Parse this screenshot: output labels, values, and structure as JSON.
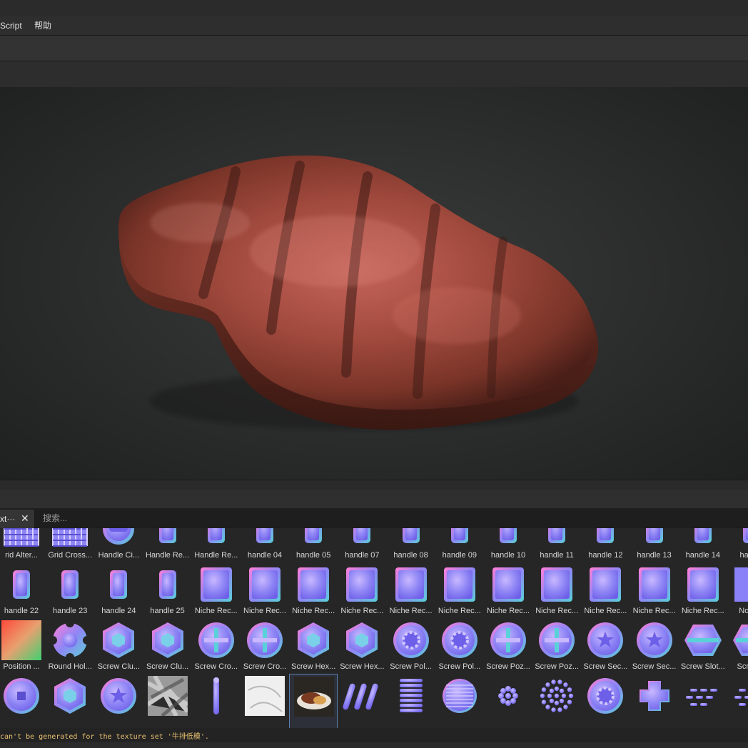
{
  "menubar": {
    "items": [
      {
        "label": "Script"
      },
      {
        "label": "帮助"
      }
    ]
  },
  "viewport": {
    "object": "grilled steak 3D model",
    "background": "#2c2d2d"
  },
  "shelf": {
    "tab_label": "xt···",
    "search_placeholder": "搜索...",
    "rows": [
      [
        {
          "label": "rid Alter...",
          "icon": "grid-alternate-icon"
        },
        {
          "label": "Grid Cross...",
          "icon": "grid-cross-icon"
        },
        {
          "label": "Handle Ci...",
          "icon": "handle-circle-icon"
        },
        {
          "label": "Handle Re...",
          "icon": "handle-rect-icon"
        },
        {
          "label": "Handle Re...",
          "icon": "handle-rect-icon"
        },
        {
          "label": "handle 04",
          "icon": "handle-icon"
        },
        {
          "label": "handle 05",
          "icon": "handle-icon"
        },
        {
          "label": "handle 07",
          "icon": "handle-icon"
        },
        {
          "label": "handle 08",
          "icon": "handle-icon"
        },
        {
          "label": "handle 09",
          "icon": "handle-icon"
        },
        {
          "label": "handle 10",
          "icon": "handle-icon"
        },
        {
          "label": "handle 11",
          "icon": "handle-icon"
        },
        {
          "label": "handle 12",
          "icon": "handle-icon"
        },
        {
          "label": "handle 13",
          "icon": "handle-icon"
        },
        {
          "label": "handle 14",
          "icon": "handle-icon"
        },
        {
          "label": "handle",
          "icon": "handle-icon"
        }
      ],
      [
        {
          "label": "handle 22",
          "icon": "handle-icon"
        },
        {
          "label": "handle 23",
          "icon": "handle-icon"
        },
        {
          "label": "handle 24",
          "icon": "handle-icon"
        },
        {
          "label": "handle 25",
          "icon": "handle-icon"
        },
        {
          "label": "Niche Rec...",
          "icon": "niche-rect-icon"
        },
        {
          "label": "Niche Rec...",
          "icon": "niche-rect-icon"
        },
        {
          "label": "Niche Rec...",
          "icon": "niche-rect-icon"
        },
        {
          "label": "Niche Rec...",
          "icon": "niche-rect-icon"
        },
        {
          "label": "Niche Rec...",
          "icon": "niche-rect-icon"
        },
        {
          "label": "Niche Rec...",
          "icon": "niche-rect-icon"
        },
        {
          "label": "Niche Rec...",
          "icon": "niche-rect-icon"
        },
        {
          "label": "Niche Rec...",
          "icon": "niche-rect-icon"
        },
        {
          "label": "Niche Rec...",
          "icon": "niche-rect-icon"
        },
        {
          "label": "Niche Rec...",
          "icon": "niche-rect-icon"
        },
        {
          "label": "Niche Rec...",
          "icon": "niche-rect-icon"
        },
        {
          "label": "Normal",
          "icon": "normal-icon"
        }
      ],
      [
        {
          "label": "Position ...",
          "icon": "position-gradient-icon"
        },
        {
          "label": "Round Hol...",
          "icon": "round-hole-icon"
        },
        {
          "label": "Screw Clu...",
          "icon": "screw-clutch-icon"
        },
        {
          "label": "Screw Clu...",
          "icon": "screw-clutch-icon"
        },
        {
          "label": "Screw Cro...",
          "icon": "screw-cross-icon"
        },
        {
          "label": "Screw Cro...",
          "icon": "screw-cross-icon"
        },
        {
          "label": "Screw Hex...",
          "icon": "screw-hex-icon"
        },
        {
          "label": "Screw Hex...",
          "icon": "screw-hex-icon"
        },
        {
          "label": "Screw Pol...",
          "icon": "screw-polydrive-icon"
        },
        {
          "label": "Screw Pol...",
          "icon": "screw-polydrive-icon"
        },
        {
          "label": "Screw Poz...",
          "icon": "screw-pozidriv-icon"
        },
        {
          "label": "Screw Poz...",
          "icon": "screw-pozidriv-icon"
        },
        {
          "label": "Screw Sec...",
          "icon": "screw-security-icon"
        },
        {
          "label": "Screw Sec...",
          "icon": "screw-security-icon"
        },
        {
          "label": "Screw Slot...",
          "icon": "screw-slot-icon"
        },
        {
          "label": "Screw S",
          "icon": "screw-slot-icon"
        }
      ],
      [
        {
          "label": "",
          "icon": "screw-square-icon"
        },
        {
          "label": "",
          "icon": "screw-hex-star-icon"
        },
        {
          "label": "",
          "icon": "screw-star-icon"
        },
        {
          "label": "",
          "icon": "grunge-texture-icon"
        },
        {
          "label": "",
          "icon": "pin-icon"
        },
        {
          "label": "",
          "icon": "scratch-texture-icon"
        },
        {
          "label": "",
          "icon": "steak-photo-icon"
        },
        {
          "label": "",
          "icon": "diagonal-stripes-icon"
        },
        {
          "label": "",
          "icon": "horizontal-stripes-icon"
        },
        {
          "label": "",
          "icon": "vent-circle-icon"
        },
        {
          "label": "",
          "icon": "dot-cluster-icon"
        },
        {
          "label": "",
          "icon": "dot-circle-icon"
        },
        {
          "label": "",
          "icon": "gear-disc-icon"
        },
        {
          "label": "",
          "icon": "cross-shape-icon"
        },
        {
          "label": "",
          "icon": "dashes-icon"
        },
        {
          "label": "",
          "icon": "dashes-icon"
        }
      ]
    ]
  },
  "status": {
    "message": "can't be generated for the texture set '牛排低模'."
  }
}
